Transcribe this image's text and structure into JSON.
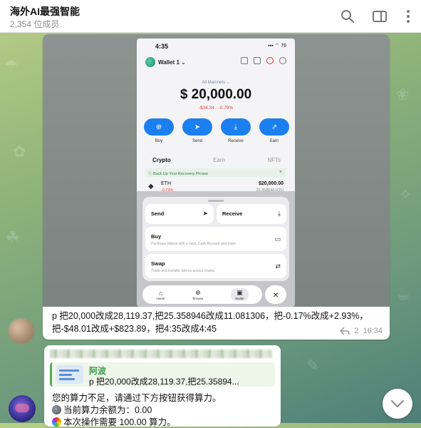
{
  "header": {
    "title": "海外AI最强智能",
    "subtitle": "2,354 位成员"
  },
  "message1": {
    "screenshot": {
      "status_time": "4:35",
      "status_right": "▪▪▪ ⌔ 76",
      "wallet_name": "Wallet 1 ⌄",
      "network": "All Mainnets ⌄",
      "balance": "$ 20,000.00",
      "change": "-$34.34  ·  -0.79%",
      "actions": [
        {
          "label": "Buy",
          "icon": "⊕"
        },
        {
          "label": "Send",
          "icon": "➤"
        },
        {
          "label": "Receive",
          "icon": "⤓"
        },
        {
          "label": "Earn",
          "icon": "⇗"
        }
      ],
      "tabs": [
        "Crypto",
        "Earn",
        "NFTs"
      ],
      "backup_banner": "ⓘ Back Up Your Recovery Phrase",
      "token": {
        "name": "ETH",
        "change": "-0.79%",
        "value": "$20,000.00",
        "quantity": "25.358946 ETH"
      },
      "sheet": {
        "send_label": "Send",
        "receive_label": "Receive",
        "buy_label": "Buy",
        "buy_desc": "Purchase tokens with a card, Cash Account and more",
        "swap_label": "Swap",
        "swap_desc": "Trade and transfer tokens across chains"
      },
      "bottom_nav": [
        "Home",
        "Browse",
        "Wallet"
      ]
    },
    "caption": "p 把20,000改成28,119.37,把25.358946改成11.081306，把-0.17%改成+2.93%，把-$48.01改成+$823.89，把4:35改成4:45",
    "reply_count": "2",
    "time": "16:34"
  },
  "message2": {
    "quote": {
      "name": "阿波",
      "text": "p 把20,000改成28,119.37,把25.35894..."
    },
    "lines": [
      "您的算力不足，请通过下方按钮获得算力。",
      "当前算力余额为：0.00",
      "本次操作需要 100.00 算力。"
    ]
  },
  "icons": {
    "search": "search-icon",
    "sidebar": "sidebar-toggle-icon",
    "more": "more-vertical-icon",
    "reply": "reply-icon",
    "scroll_down": "chevron-down-icon"
  },
  "colors": {
    "accent_blue": "#1b7ff0",
    "quote_green": "#3f9d4b",
    "negative": "#dd4444"
  }
}
